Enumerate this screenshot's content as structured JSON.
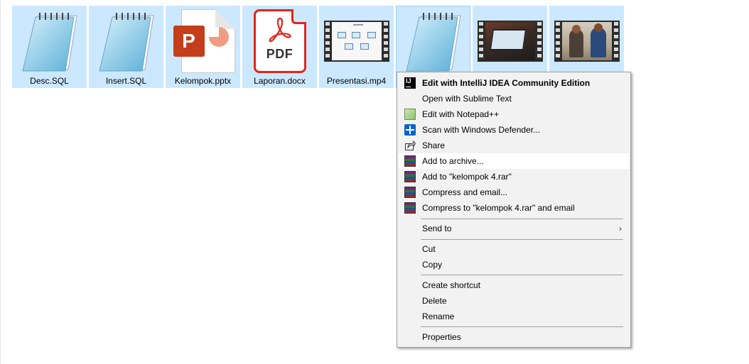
{
  "files": [
    {
      "name": "Desc.SQL",
      "icon": "notepad-icon",
      "thumb": "notepad"
    },
    {
      "name": "Insert.SQL",
      "icon": "notepad-icon",
      "thumb": "notepad"
    },
    {
      "name": "Kelompok.pptx",
      "icon": "powerpoint-icon",
      "thumb": "pptx",
      "badge": "P"
    },
    {
      "name": "Laporan.docx",
      "icon": "pdf-icon",
      "thumb": "pdf",
      "badge": "PDF"
    },
    {
      "name": "Presentasi.mp4",
      "icon": "video-thumbnail-icon",
      "thumb": "video-slide"
    },
    {
      "name": "",
      "icon": "notepad-icon",
      "thumb": "notepad"
    },
    {
      "name": "",
      "icon": "video-thumbnail-icon",
      "thumb": "video-laptop"
    },
    {
      "name": "",
      "icon": "video-thumbnail-icon",
      "thumb": "video-people"
    }
  ],
  "context_menu": {
    "items": [
      {
        "label": "Edit with IntelliJ IDEA Community Edition",
        "icon": "intellij-icon",
        "bold": true
      },
      {
        "label": "Open with Sublime Text",
        "icon": ""
      },
      {
        "label": "Edit with Notepad++",
        "icon": "notepadpp-icon"
      },
      {
        "label": "Scan with Windows Defender...",
        "icon": "windows-defender-icon"
      },
      {
        "label": "Share",
        "icon": "share-icon"
      },
      {
        "label": "Add to archive...",
        "icon": "winrar-icon",
        "highlighted": true
      },
      {
        "label": "Add to \"kelompok 4.rar\"",
        "icon": "winrar-icon"
      },
      {
        "label": "Compress and email...",
        "icon": "winrar-icon"
      },
      {
        "label": "Compress to \"kelompok 4.rar\" and email",
        "icon": "winrar-icon"
      },
      {
        "label": "Send to",
        "submenu": true
      },
      {
        "label": "Cut"
      },
      {
        "label": "Copy"
      },
      {
        "label": "Create shortcut"
      },
      {
        "label": "Delete"
      },
      {
        "label": "Rename"
      },
      {
        "label": "Properties"
      }
    ],
    "submenu_arrow": "›"
  },
  "colors": {
    "selection": "#cce8ff",
    "menu_bg": "#f2f2f2",
    "menu_highlight": "#ffffff"
  }
}
